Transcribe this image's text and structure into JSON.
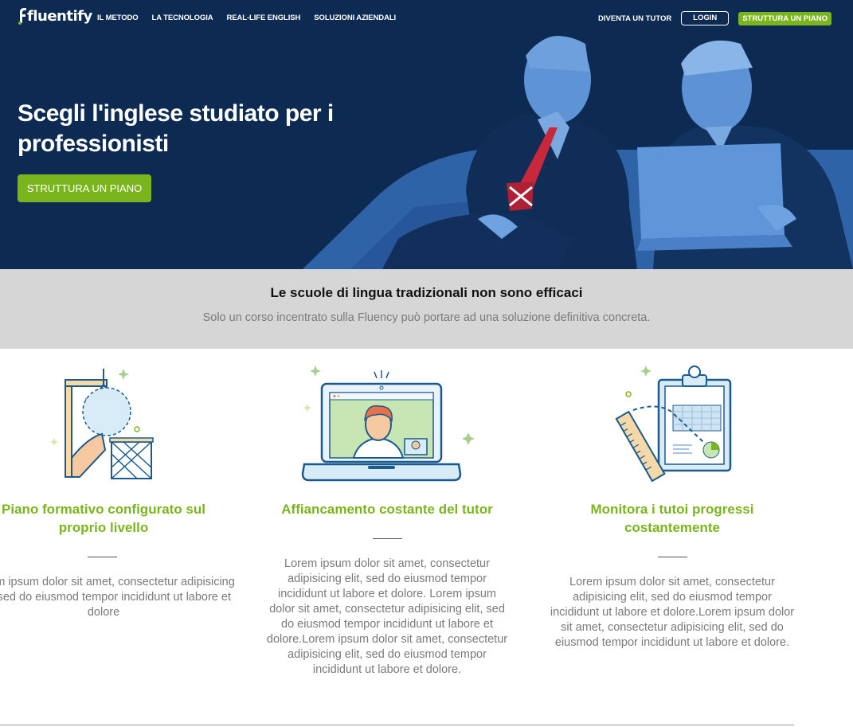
{
  "nav": {
    "logo_text": "fluentify",
    "links": [
      "IL METODO",
      "LA TECNOLOGIA",
      "REAL-LIFE ENGLISH",
      "SOLUZIONI AZIENDALI"
    ],
    "tutor_label": "DIVENTA UN TUTOR",
    "login_label": "LOGIN",
    "plan_label": "STRUTTURA UN PIANO"
  },
  "hero": {
    "title": "Scegli l'inglese studiato per i professionisti",
    "cta_label": "STRUTTURA UN PIANO"
  },
  "band": {
    "title": "Le scuole di lingua tradizionali non sono efficaci",
    "subtitle": "Solo un corso incentrato sulla Fluency può portare ad una soluzione definitiva concreta."
  },
  "features": [
    {
      "title": "Piano formativo configurato sul proprio livello",
      "text": "Lorem ipsum dolor sit amet, consectetur adipisicing elit, sed do eiusmod tempor incididunt ut labore et dolore"
    },
    {
      "title": "Affiancamento costante del tutor",
      "text": "Lorem ipsum dolor sit amet, consectetur adipisicing elit, sed do eiusmod tempor incididunt ut labore et dolore. Lorem ipsum dolor sit amet, consectetur adipisicing elit, sed do eiusmod tempor incididunt ut labore et dolore.Lorem ipsum dolor sit amet, consectetur adipisicing elit, sed do eiusmod tempor incididunt ut labore et dolore."
    },
    {
      "title": "Monitora i tutoi progressi costantemente",
      "text": "Lorem ipsum dolor sit amet, consectetur adipisicing elit, sed do eiusmod tempor incididunt ut labore et dolore.Lorem ipsum dolor sit amet, consectetur adipisicing elit, sed do eiusmod tempor incididunt ut labore et dolore."
    }
  ],
  "colors": {
    "hero_bg": "#0d2b52",
    "accent_green": "#7ab51d",
    "band_bg": "#d6d6d6",
    "illustration_blue": "#1a5a8f"
  },
  "icons": [
    "fluentify-logo-icon",
    "crane-level-illustration",
    "laptop-tutor-illustration",
    "clipboard-progress-illustration"
  ]
}
